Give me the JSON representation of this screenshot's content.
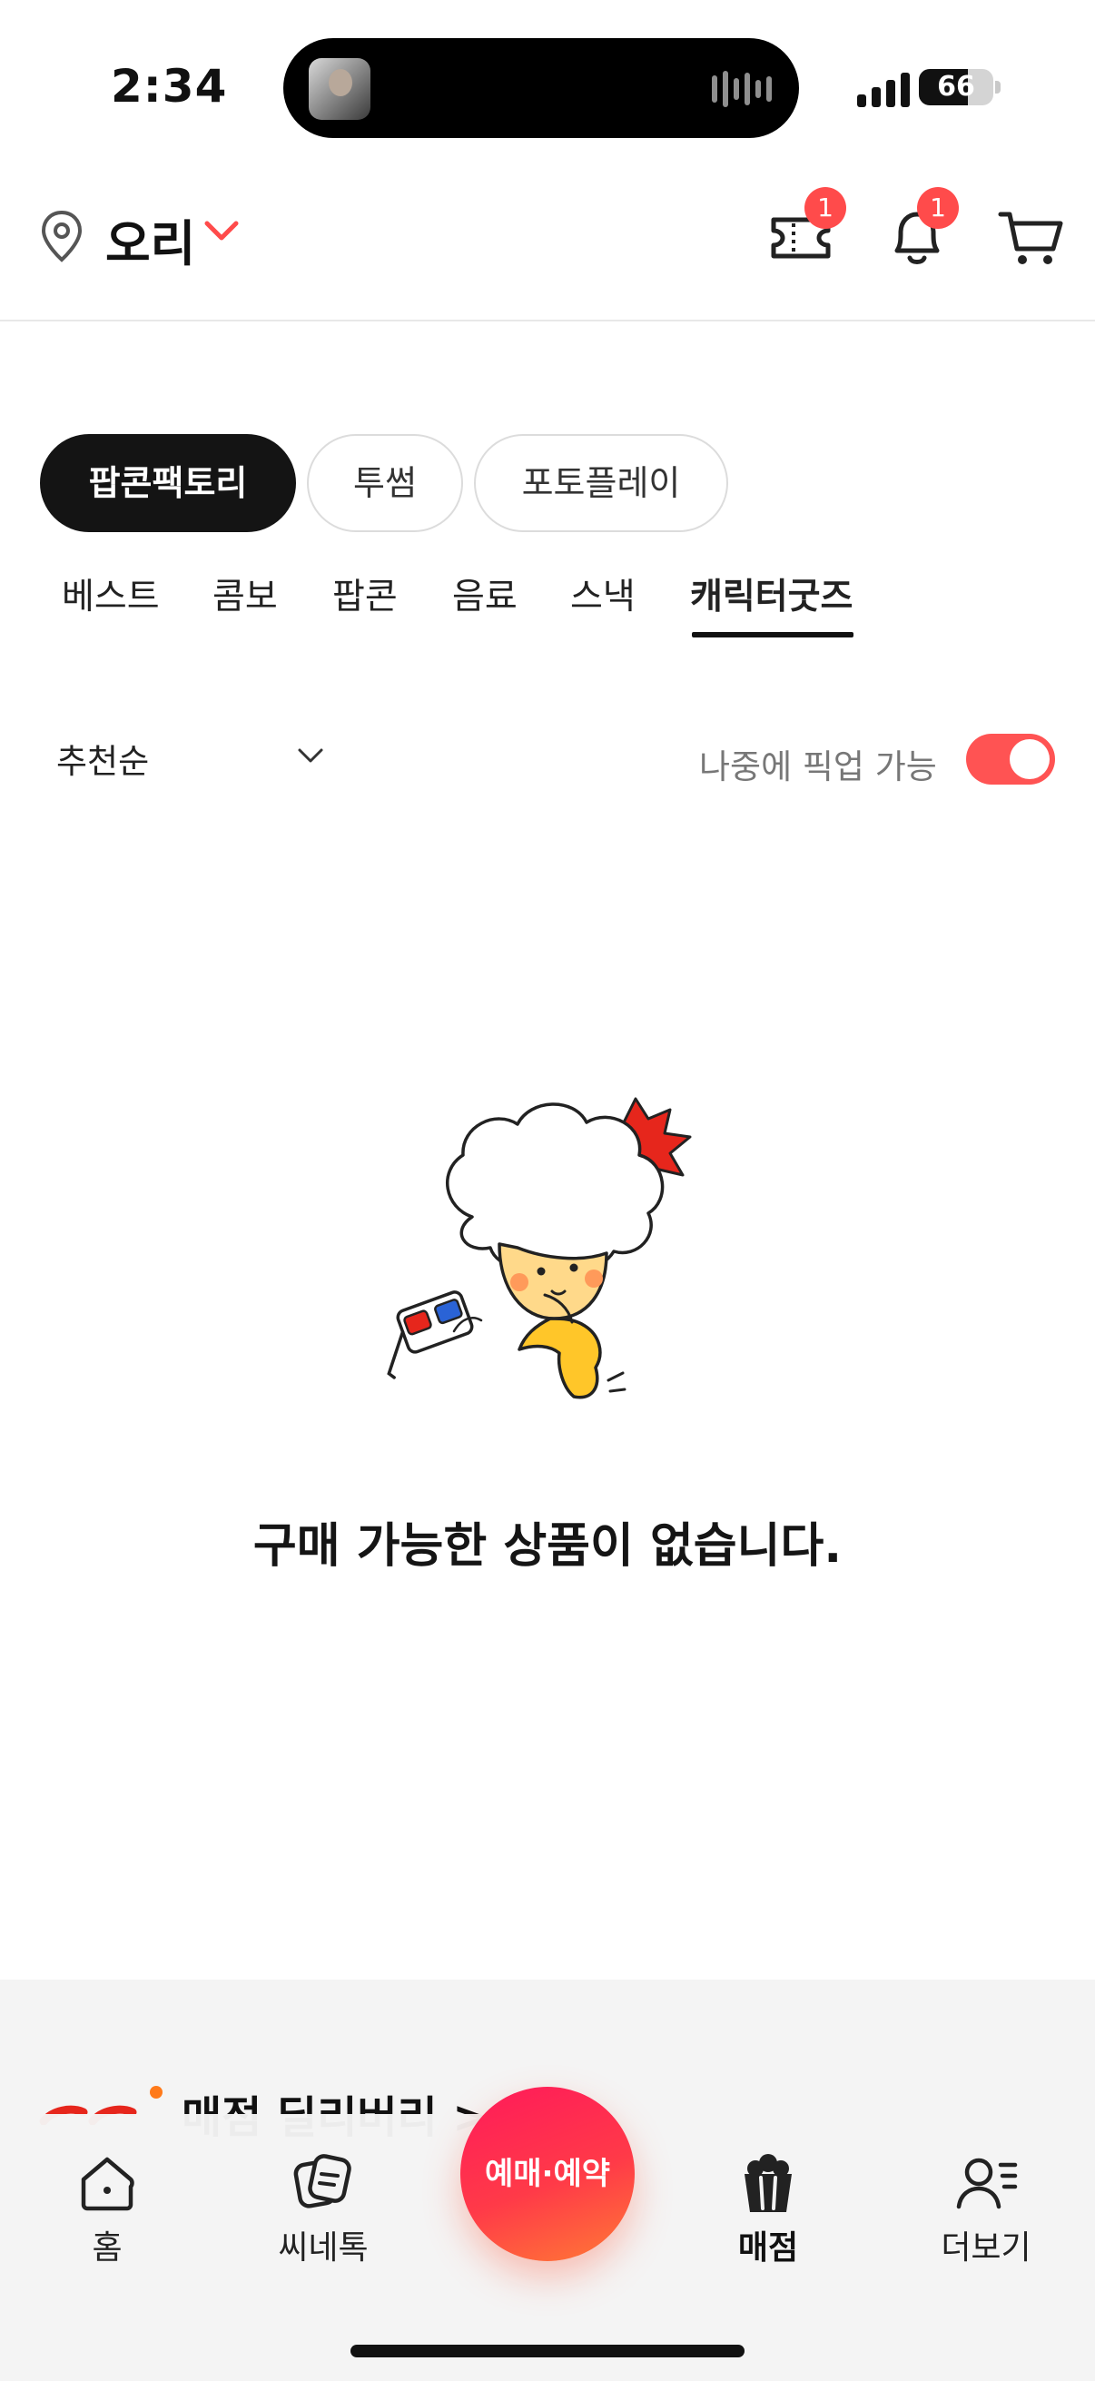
{
  "status_bar": {
    "time": "2:34",
    "battery_percent": "66",
    "battery_level": 0.66
  },
  "header": {
    "location": "오리",
    "ticket_badge": "1",
    "bell_badge": "1",
    "accent_color": "#ff4b4b"
  },
  "brand_chips": [
    {
      "label": "팝콘팩토리",
      "active": true
    },
    {
      "label": "투썸",
      "active": false
    },
    {
      "label": "포토플레이",
      "active": false
    }
  ],
  "category_tabs": [
    {
      "label": "베스트",
      "active": false
    },
    {
      "label": "콤보",
      "active": false
    },
    {
      "label": "팝콘",
      "active": false
    },
    {
      "label": "음료",
      "active": false
    },
    {
      "label": "스낵",
      "active": false
    },
    {
      "label": "캐릭터굿즈",
      "active": true
    }
  ],
  "filters": {
    "sort_label": "추천순",
    "pickup_label": "나중에 픽업 가능",
    "pickup_enabled": true
  },
  "empty_state": {
    "message": "구매 가능한 상품이 없습니다."
  },
  "delivery": {
    "text": "매점 딜리버리 >"
  },
  "bottom_nav": {
    "home": "홈",
    "cinetalk": "씨네톡",
    "reserve": "예매·예약",
    "store": "매점",
    "more": "더보기",
    "active": "store"
  },
  "icons": [
    "location-pin-icon",
    "chevron-down-icon",
    "ticket-icon",
    "bell-icon",
    "cart-icon",
    "home-icon",
    "cinetalk-icon",
    "popcorn-icon",
    "more-user-icon"
  ]
}
